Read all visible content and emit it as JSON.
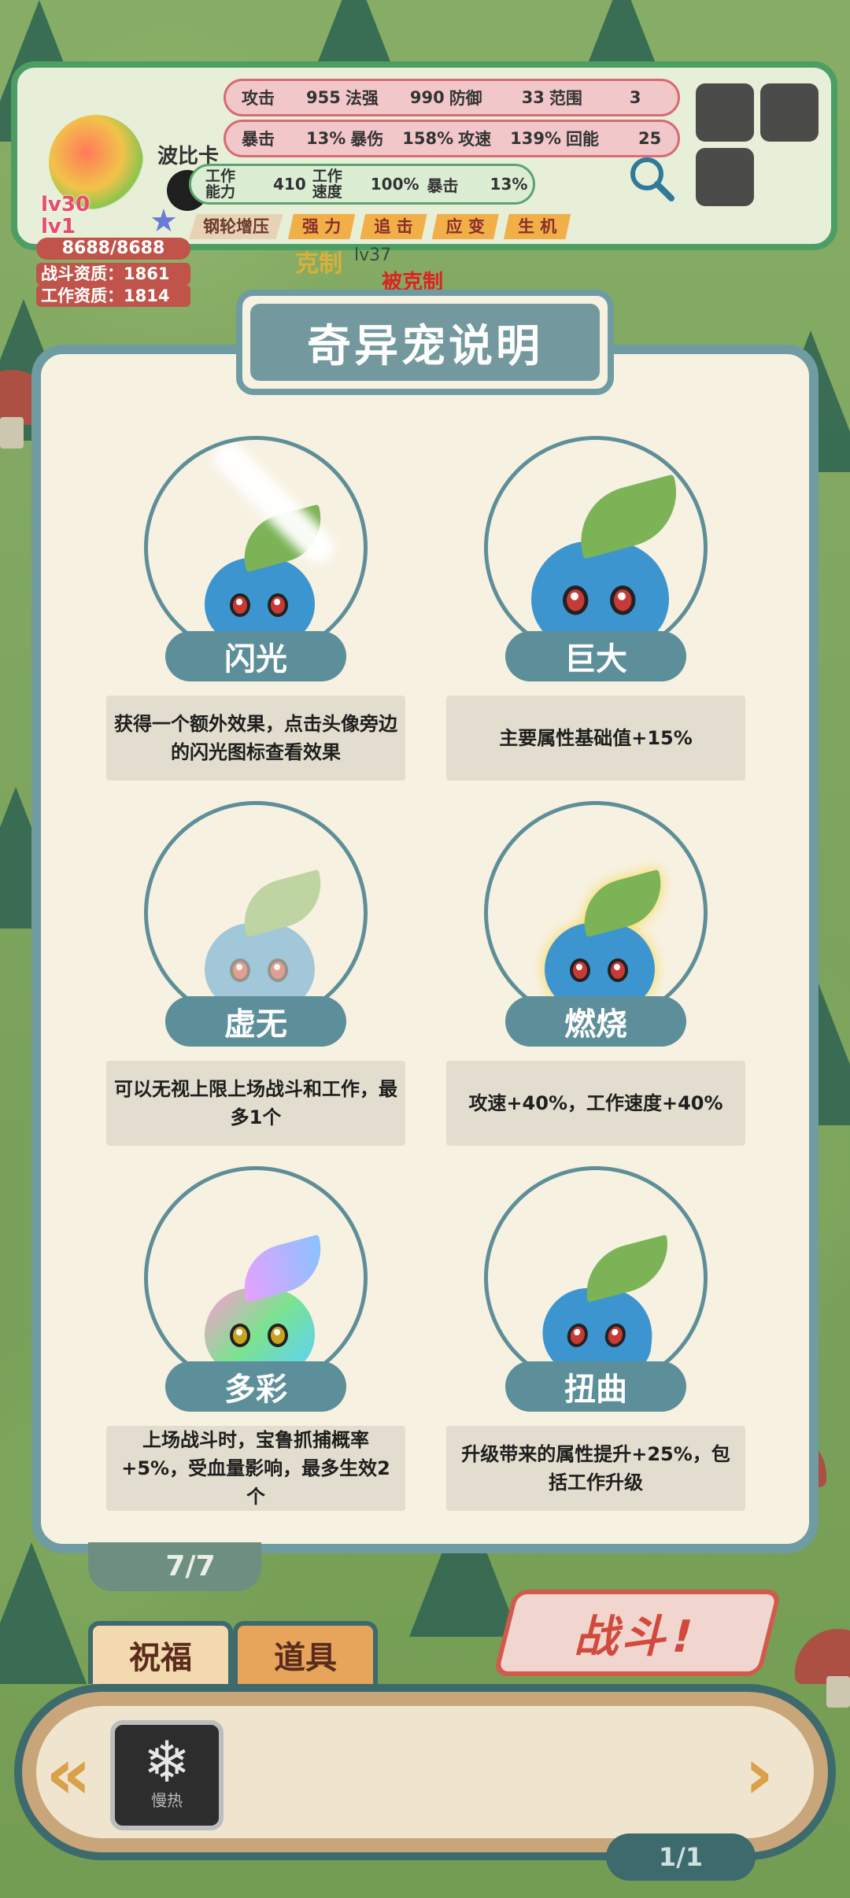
{
  "header": {
    "pet_name": "波比卡",
    "level_main": "lv30",
    "level_sub": "lv1",
    "hp": "8688/8688",
    "battle_aptitude": "战斗资质：1861",
    "work_aptitude": "工作资质：1814",
    "stats_row1": [
      "攻击",
      "955",
      "法强",
      "990",
      "防御",
      "33",
      "范围",
      "3"
    ],
    "stats_row2": [
      "暴击",
      "13%",
      "暴伤",
      "158%",
      "攻速",
      "139%",
      "回能",
      "25"
    ],
    "work_label1": "工作能力",
    "work_value1": "410",
    "work_label2": "工作速度",
    "work_value2": "100%",
    "work_label3": "暴击",
    "work_value3": "13%",
    "traits": [
      "钢轮增压",
      "强 力",
      "追 击",
      "应 变",
      "生 机"
    ],
    "counter_text": "克制",
    "counter_level": "lv37",
    "counter_red": "被克制"
  },
  "modal": {
    "title": "奇异宠说明",
    "cards": [
      {
        "label": "闪光",
        "desc": "获得一个额外效果，点击头像旁边的闪光图标查看效果"
      },
      {
        "label": "巨大",
        "desc": "主要属性基础值+15%"
      },
      {
        "label": "虚无",
        "desc": "可以无视上限上场战斗和工作，最多1个"
      },
      {
        "label": "燃烧",
        "desc": "攻速+40%，工作速度+40%"
      },
      {
        "label": "多彩",
        "desc": "上场战斗时，宝鲁抓捕概率+5%，受血量影响，最多生效2个"
      },
      {
        "label": "扭曲",
        "desc": "升级带来的属性提升+25%，包括工作升级"
      }
    ]
  },
  "bottom": {
    "team_count": "7/7",
    "tabs": [
      "祝福",
      "道具"
    ],
    "battle_button": "战斗!",
    "item_label": "慢热",
    "page": "1/1"
  },
  "icons": {
    "search": "search-icon",
    "snowflake": "snowflake-icon",
    "left_arrow": "double-chevron-left-icon",
    "right_arrow": "chevron-right-icon"
  },
  "colors": {
    "modal_border": "#6f9ba3",
    "label_pill": "#5c8f99",
    "panel_border": "#4d9e62",
    "battle_red": "#d24a3e"
  }
}
